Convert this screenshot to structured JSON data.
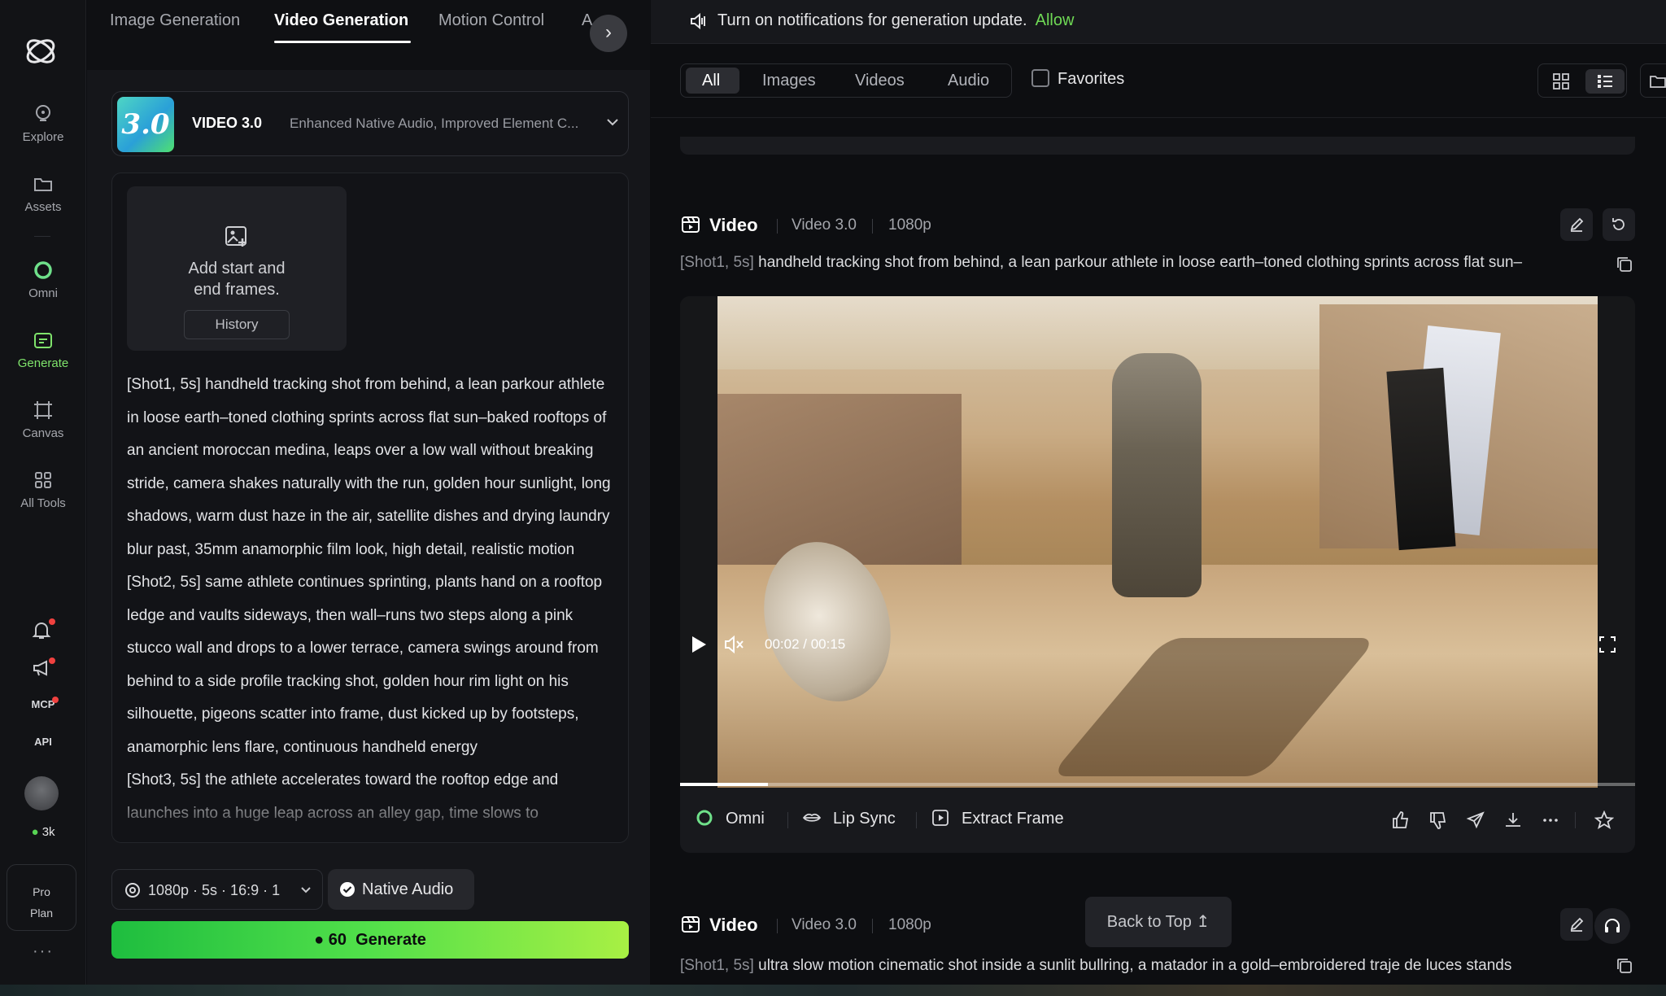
{
  "rail": {
    "items": [
      {
        "label": "Explore"
      },
      {
        "label": "Assets"
      },
      {
        "label": "Omni"
      },
      {
        "label": "Generate"
      },
      {
        "label": "Canvas"
      },
      {
        "label": "All Tools"
      }
    ],
    "mcp": "MCP",
    "api": "API",
    "credits": "3k",
    "pro_line1": "Pro",
    "pro_line2": "Plan",
    "more": "···"
  },
  "tabs": [
    "Image Generation",
    "Video Generation",
    "Motion Control",
    "A"
  ],
  "model": {
    "badge": "3.0",
    "name": "VIDEO 3.0",
    "description": "Enhanced Native Audio, Improved Element C..."
  },
  "frames": {
    "line1": "Add start and",
    "line2": "end frames.",
    "history": "History"
  },
  "prompt": [
    "[Shot1, 5s] handheld tracking shot from behind, a lean parkour athlete in loose earth–toned clothing sprints across flat sun–baked rooftops of an ancient moroccan medina, leaps over a low wall without breaking stride, camera shakes naturally with the run, golden hour sunlight, long shadows, warm dust haze in the air, satellite dishes and drying laundry blur past, 35mm anamorphic film look, high detail, realistic motion",
    "[Shot2, 5s] same athlete continues sprinting, plants hand on a rooftop ledge and vaults sideways, then wall–runs two steps along a pink stucco wall and drops to a lower terrace, camera swings around from behind to a side profile tracking shot, golden hour rim light on his silhouette, pigeons scatter into frame, dust kicked up by footsteps, anamorphic lens flare, continuous handheld energy",
    "[Shot3, 5s] the athlete accelerates toward the rooftop edge and launches into a huge leap across an alley gap, time slows to"
  ],
  "params": {
    "settings": "1080p · 5s · 16:9 · 1",
    "native_audio": "Native Audio",
    "generate_cost": "60",
    "generate_label": "Generate"
  },
  "notification": {
    "text": "Turn on notifications for generation update.",
    "action": "Allow"
  },
  "filters": [
    "All",
    "Images",
    "Videos",
    "Audio"
  ],
  "favorites": "Favorites",
  "results": [
    {
      "title": "Video",
      "model": "Video 3.0",
      "resolution": "1080p",
      "tag": "[Shot1, 5s]",
      "prompt": "handheld tracking shot from behind, a lean parkour athlete in loose earth–toned clothing sprints across flat sun–",
      "time_current": "00:02",
      "time_total": "00:15",
      "progress": 0.092
    },
    {
      "title": "Video",
      "model": "Video 3.0",
      "resolution": "1080p",
      "tag": "[Shot1, 5s]",
      "prompt": "ultra slow motion cinematic shot inside a sunlit bullring, a matador in a gold–embroidered traje de luces stands"
    }
  ],
  "actions": {
    "omni": "Omni",
    "lip_sync": "Lip Sync",
    "extract_frame": "Extract Frame"
  },
  "back_to_top": "Back to Top"
}
